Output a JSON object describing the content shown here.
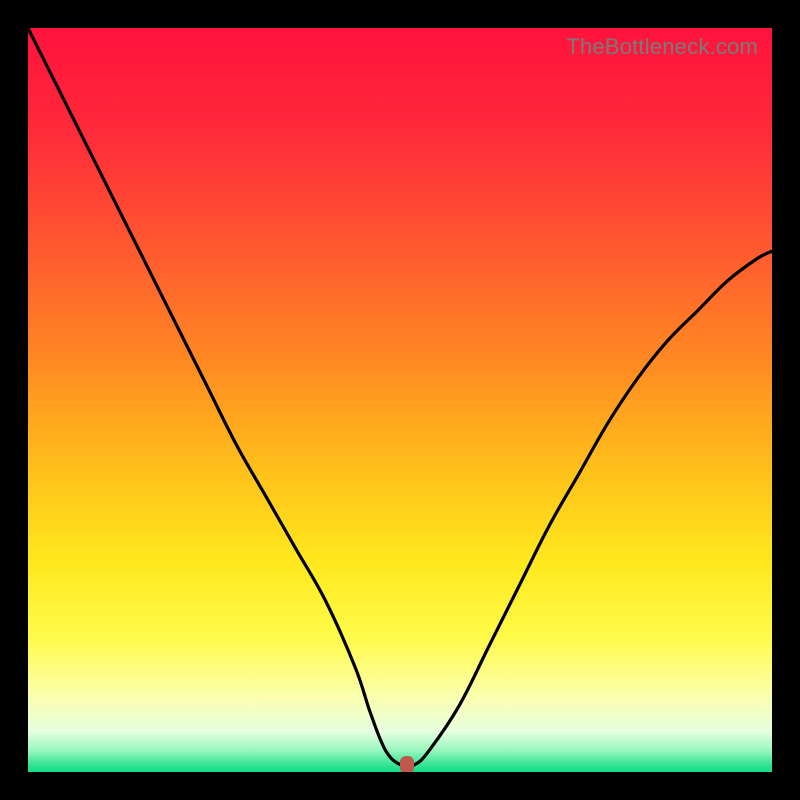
{
  "watermark": "TheBottleneck.com",
  "colors": {
    "frame": "#000000",
    "curve": "#000000",
    "marker": "#c1584e",
    "gradient_stops": [
      {
        "offset": 0.0,
        "color": "#ff123c"
      },
      {
        "offset": 0.14,
        "color": "#ff2a3a"
      },
      {
        "offset": 0.3,
        "color": "#ff5a2f"
      },
      {
        "offset": 0.45,
        "color": "#ff8a22"
      },
      {
        "offset": 0.6,
        "color": "#ffc21a"
      },
      {
        "offset": 0.72,
        "color": "#ffe91e"
      },
      {
        "offset": 0.82,
        "color": "#fffb4a"
      },
      {
        "offset": 0.9,
        "color": "#faffb0"
      },
      {
        "offset": 0.945,
        "color": "#e7ffe0"
      },
      {
        "offset": 0.97,
        "color": "#9cf7c0"
      },
      {
        "offset": 0.99,
        "color": "#35e594"
      },
      {
        "offset": 1.0,
        "color": "#14db84"
      }
    ]
  },
  "chart_data": {
    "type": "line",
    "title": "",
    "xlabel": "",
    "ylabel": "",
    "xlim": [
      0,
      100
    ],
    "ylim": [
      0,
      100
    ],
    "grid": false,
    "legend": false,
    "series": [
      {
        "name": "bottleneck-curve",
        "x": [
          0,
          4,
          8,
          12,
          16,
          20,
          24,
          28,
          32,
          36,
          40,
          44,
          46,
          48,
          50,
          52,
          54,
          58,
          62,
          66,
          70,
          74,
          78,
          82,
          86,
          90,
          94,
          98,
          100
        ],
        "y": [
          100,
          92,
          84,
          76,
          68,
          60,
          52,
          44,
          37,
          30,
          23,
          14,
          8,
          3,
          1,
          1,
          3,
          9,
          17,
          25,
          33,
          40,
          47,
          53,
          58,
          62,
          66,
          69,
          70
        ]
      }
    ],
    "marker": {
      "x": 51,
      "y": 1
    }
  }
}
